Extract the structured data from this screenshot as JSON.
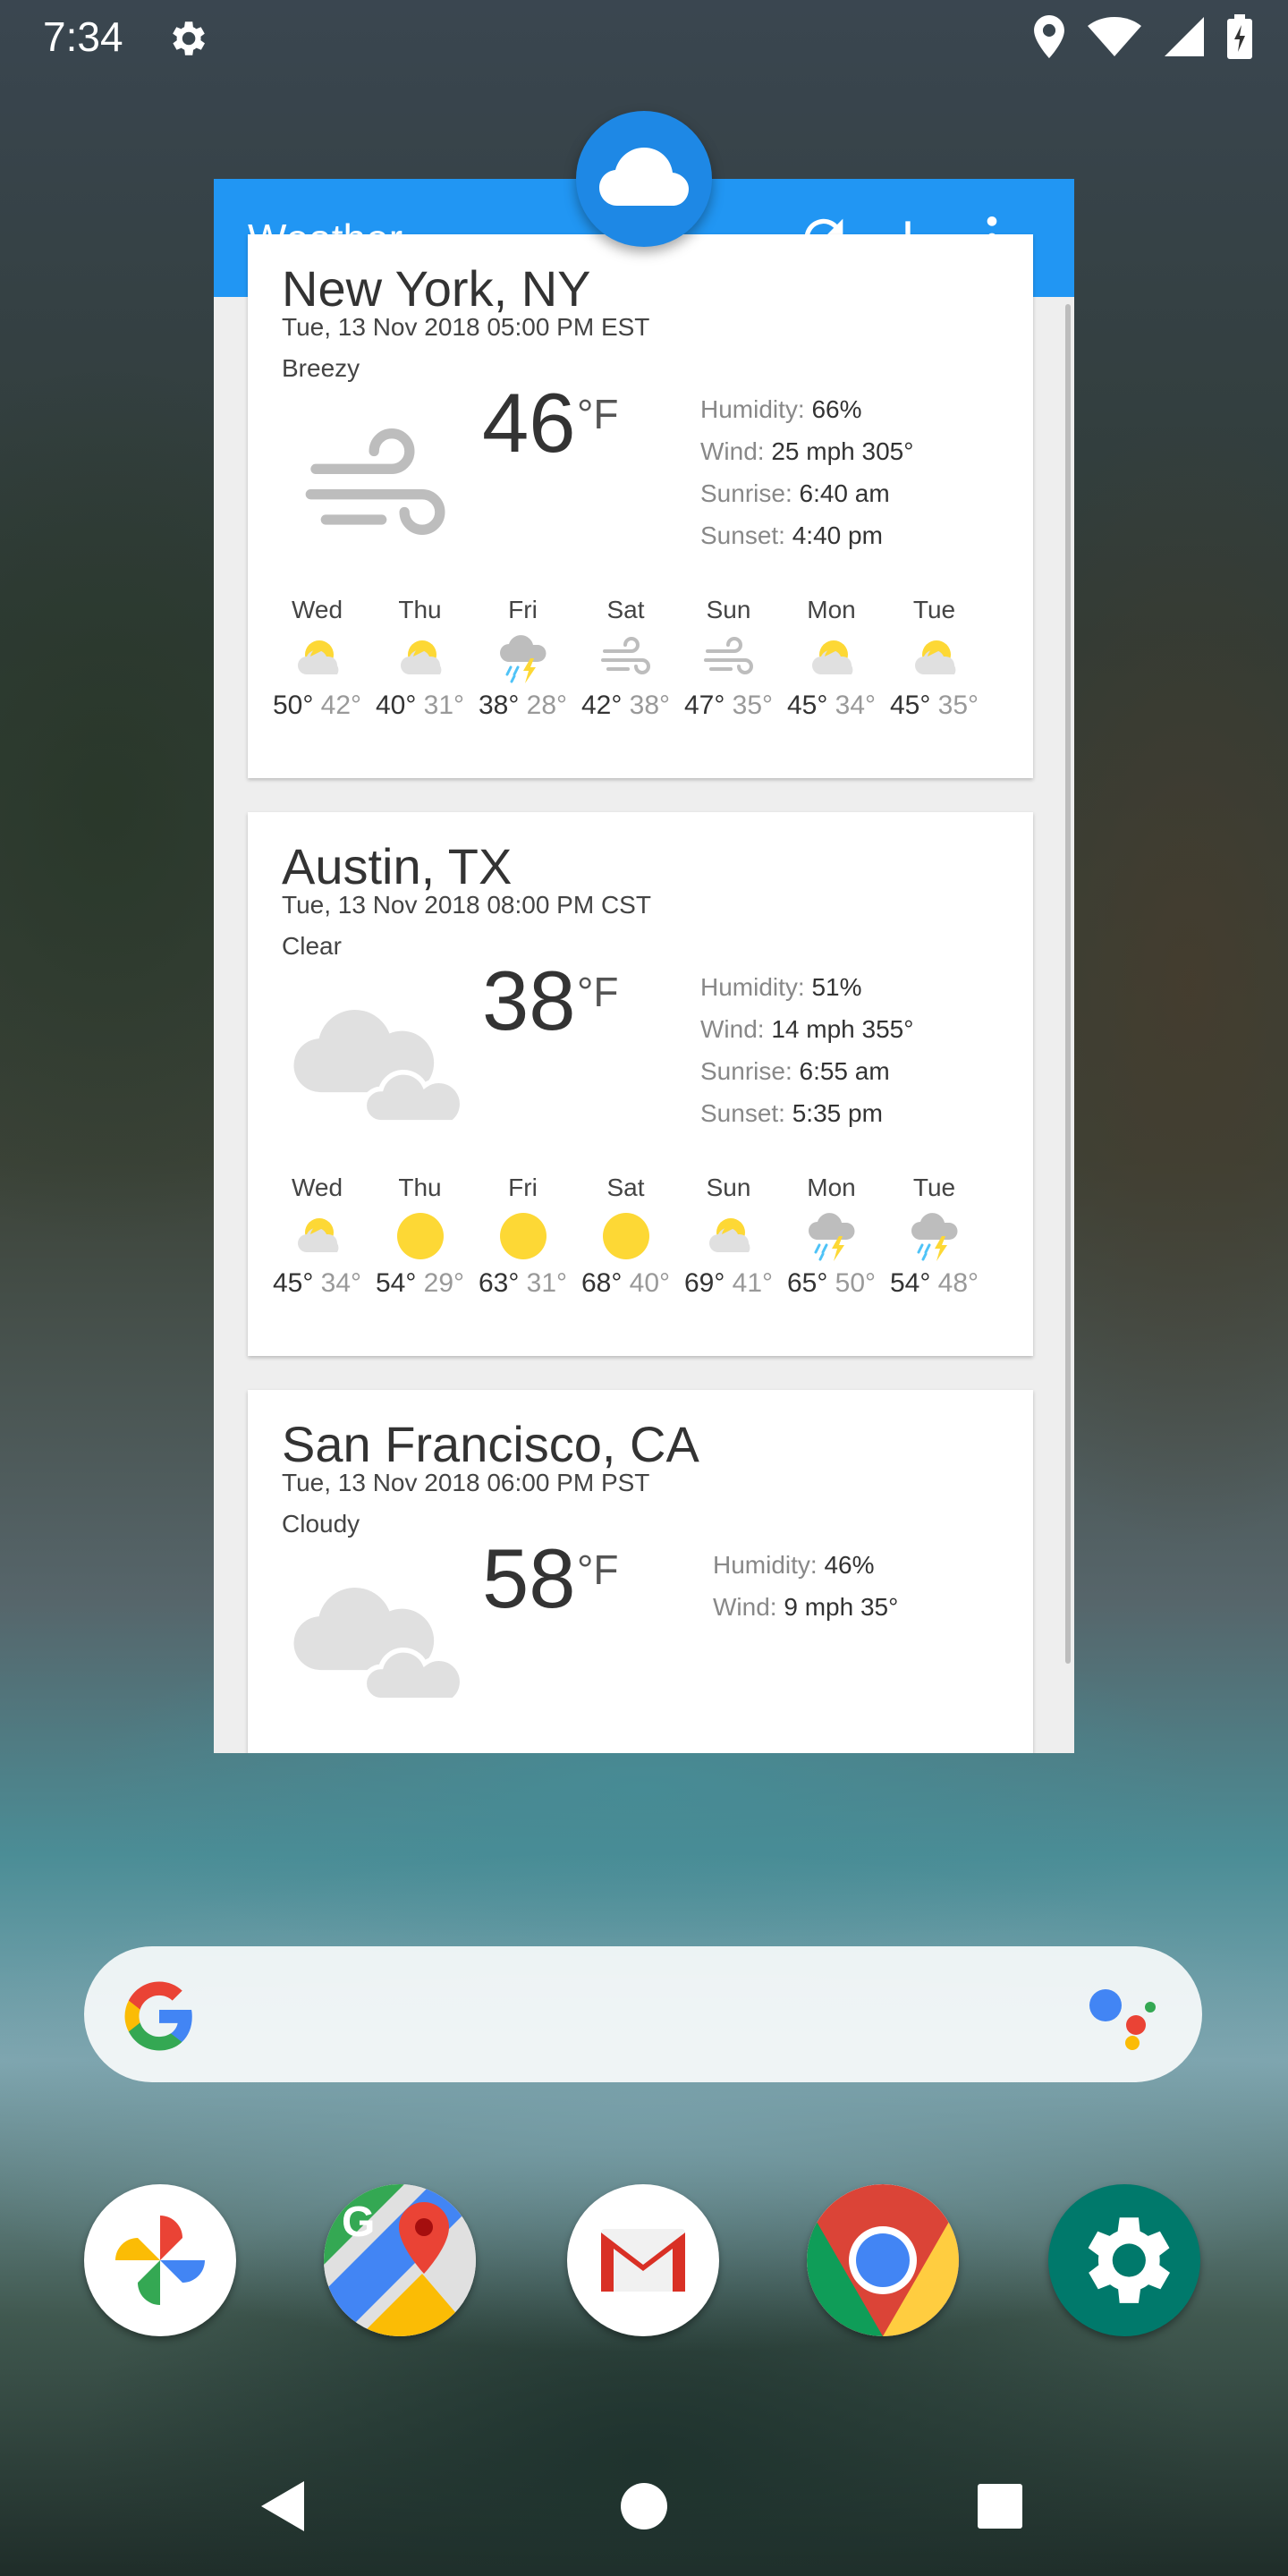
{
  "status_bar": {
    "time": "7:34"
  },
  "widget": {
    "title": "Weather",
    "cities": [
      {
        "name": "New York, NY",
        "datetime": "Tue, 13 Nov 2018 05:00 PM EST",
        "condition": "Breezy",
        "icon": "wind-icon",
        "temp": "46",
        "unit": "°F",
        "humidity_label": "Humidity:",
        "humidity": "66%",
        "wind_label": "Wind:",
        "wind": "25 mph 305°",
        "sunrise_label": "Sunrise:",
        "sunrise": "6:40 am",
        "sunset_label": "Sunset:",
        "sunset": "4:40 pm",
        "forecast": [
          {
            "day": "Wed",
            "icon": "partly-sunny-icon",
            "hi": "50°",
            "lo": "42°"
          },
          {
            "day": "Thu",
            "icon": "partly-sunny-icon",
            "hi": "40°",
            "lo": "31°"
          },
          {
            "day": "Fri",
            "icon": "thunderstorm-icon",
            "hi": "38°",
            "lo": "28°"
          },
          {
            "day": "Sat",
            "icon": "wind-icon",
            "hi": "42°",
            "lo": "38°"
          },
          {
            "day": "Sun",
            "icon": "wind-icon",
            "hi": "47°",
            "lo": "35°"
          },
          {
            "day": "Mon",
            "icon": "partly-sunny-icon",
            "hi": "45°",
            "lo": "34°"
          },
          {
            "day": "Tue",
            "icon": "partly-sunny-icon",
            "hi": "45°",
            "lo": "35°"
          }
        ]
      },
      {
        "name": "Austin, TX",
        "datetime": "Tue, 13 Nov 2018 08:00 PM CST",
        "condition": "Clear",
        "icon": "cloudy-icon",
        "temp": "38",
        "unit": "°F",
        "humidity_label": "Humidity:",
        "humidity": "51%",
        "wind_label": "Wind:",
        "wind": "14 mph 355°",
        "sunrise_label": "Sunrise:",
        "sunrise": "6:55 am",
        "sunset_label": "Sunset:",
        "sunset": "5:35 pm",
        "forecast": [
          {
            "day": "Wed",
            "icon": "partly-sunny-icon",
            "hi": "45°",
            "lo": "34°"
          },
          {
            "day": "Thu",
            "icon": "sun-icon",
            "hi": "54°",
            "lo": "29°"
          },
          {
            "day": "Fri",
            "icon": "sun-icon",
            "hi": "63°",
            "lo": "31°"
          },
          {
            "day": "Sat",
            "icon": "sun-icon",
            "hi": "68°",
            "lo": "40°"
          },
          {
            "day": "Sun",
            "icon": "partly-sunny-icon",
            "hi": "69°",
            "lo": "41°"
          },
          {
            "day": "Mon",
            "icon": "thunderstorm-icon",
            "hi": "65°",
            "lo": "50°"
          },
          {
            "day": "Tue",
            "icon": "thunderstorm-icon",
            "hi": "54°",
            "lo": "48°"
          }
        ]
      },
      {
        "name": "San Francisco, CA",
        "datetime": "Tue, 13 Nov 2018 06:00 PM PST",
        "condition": "Cloudy",
        "icon": "cloudy-icon",
        "temp": "58",
        "unit": "°F",
        "humidity_label": "Humidity:",
        "humidity": "46%",
        "wind_label": "Wind:",
        "wind": "9 mph 35°"
      }
    ]
  },
  "dock": {
    "apps": [
      "photos-icon",
      "maps-icon",
      "gmail-icon",
      "chrome-icon",
      "settings-icon"
    ]
  },
  "colors": {
    "app_bar": "#2196f3",
    "sun": "#fdd835",
    "rain": "#4fc3f7"
  }
}
